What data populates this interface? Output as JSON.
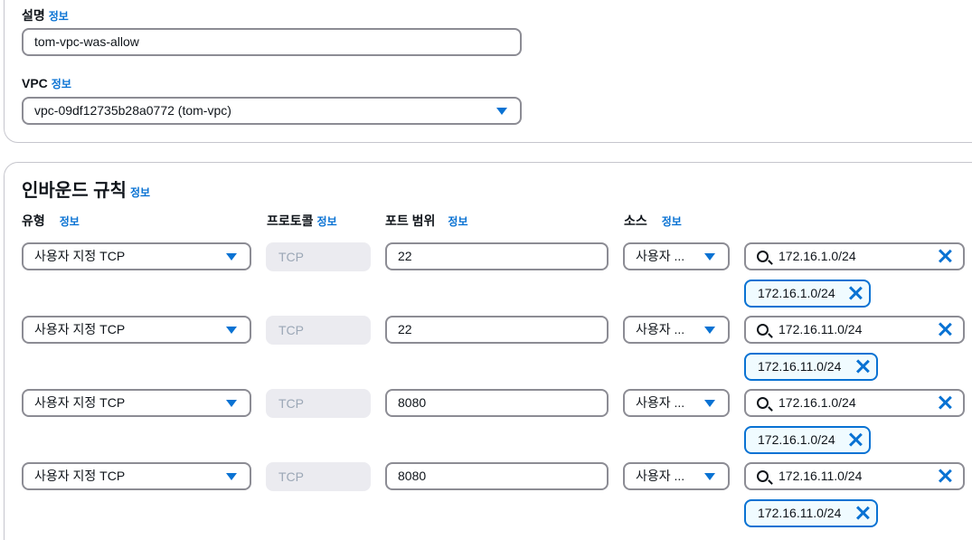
{
  "info_label": "정보",
  "description": {
    "label": "설명",
    "value": "tom-vpc-was-allow"
  },
  "vpc": {
    "label": "VPC",
    "value": "vpc-09df12735b28a0772 (tom-vpc)"
  },
  "inbound": {
    "title": "인바운드 규칙",
    "columns": {
      "type": "유형",
      "protocol": "프로토콜",
      "port": "포트 범위",
      "source": "소스"
    },
    "rules": [
      {
        "type": "사용자 지정 TCP",
        "protocol": "TCP",
        "port": "22",
        "source_type": "사용자 ...",
        "search": "172.16.1.0/24",
        "token": "172.16.1.0/24"
      },
      {
        "type": "사용자 지정 TCP",
        "protocol": "TCP",
        "port": "22",
        "source_type": "사용자 ...",
        "search": "172.16.11.0/24",
        "token": "172.16.11.0/24"
      },
      {
        "type": "사용자 지정 TCP",
        "protocol": "TCP",
        "port": "8080",
        "source_type": "사용자 ...",
        "search": "172.16.1.0/24",
        "token": "172.16.1.0/24"
      },
      {
        "type": "사용자 지정 TCP",
        "protocol": "TCP",
        "port": "8080",
        "source_type": "사용자 ...",
        "search": "172.16.11.0/24",
        "token": "172.16.11.0/24"
      }
    ]
  }
}
